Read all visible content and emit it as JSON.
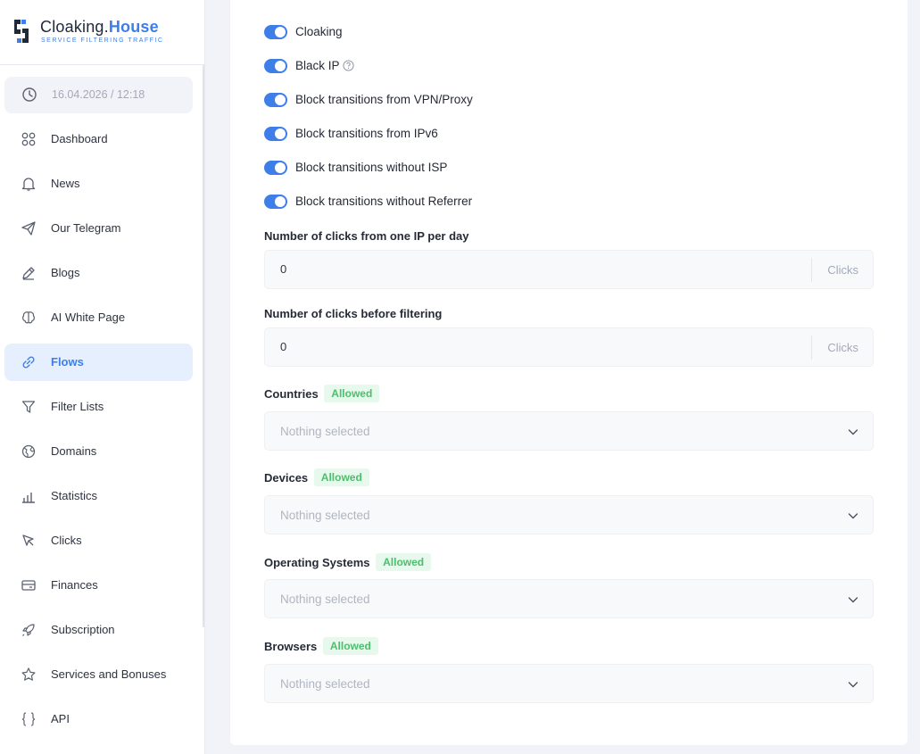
{
  "brand": {
    "name_primary": "Cloaking.",
    "name_accent": "House",
    "tagline": "SERVICE FILTERING TRAFFIC"
  },
  "sidebar": {
    "datetime": "16.04.2026 / 12:18",
    "items": [
      {
        "label": "Dashboard",
        "icon": "dashboard-icon"
      },
      {
        "label": "News",
        "icon": "bell-icon"
      },
      {
        "label": "Our Telegram",
        "icon": "telegram-icon"
      },
      {
        "label": "Blogs",
        "icon": "pencil-icon"
      },
      {
        "label": "AI White Page",
        "icon": "brain-icon"
      },
      {
        "label": "Flows",
        "icon": "link-icon",
        "active": true
      },
      {
        "label": "Filter Lists",
        "icon": "filter-icon"
      },
      {
        "label": "Domains",
        "icon": "globe-icon"
      },
      {
        "label": "Statistics",
        "icon": "bar-chart-icon"
      },
      {
        "label": "Clicks",
        "icon": "cursor-icon"
      },
      {
        "label": "Finances",
        "icon": "card-icon"
      },
      {
        "label": "Subscription",
        "icon": "rocket-icon"
      },
      {
        "label": "Services and Bonuses",
        "icon": "star-icon"
      },
      {
        "label": "API",
        "icon": "braces-icon"
      }
    ]
  },
  "settings": {
    "toggles": [
      {
        "label": "Cloaking",
        "on": true
      },
      {
        "label": "Black IP",
        "on": true,
        "help": true
      },
      {
        "label": "Block transitions from VPN/Proxy",
        "on": true
      },
      {
        "label": "Block transitions from IPv6",
        "on": true
      },
      {
        "label": "Block transitions without ISP",
        "on": true
      },
      {
        "label": "Block transitions without Referrer",
        "on": true
      }
    ],
    "clicks_per_ip": {
      "label": "Number of clicks from one IP per day",
      "value": "0",
      "unit": "Clicks"
    },
    "clicks_before_filter": {
      "label": "Number of clicks before filtering",
      "value": "0",
      "unit": "Clicks"
    },
    "filters": [
      {
        "label": "Countries",
        "badge": "Allowed",
        "placeholder": "Nothing selected"
      },
      {
        "label": "Devices",
        "badge": "Allowed",
        "placeholder": "Nothing selected"
      },
      {
        "label": "Operating Systems",
        "badge": "Allowed",
        "placeholder": "Nothing selected"
      },
      {
        "label": "Browsers",
        "badge": "Allowed",
        "placeholder": "Nothing selected"
      }
    ]
  },
  "colors": {
    "accent": "#3d7ee8",
    "badge_text": "#4cbf6b",
    "badge_bg": "#e7f8ec"
  }
}
